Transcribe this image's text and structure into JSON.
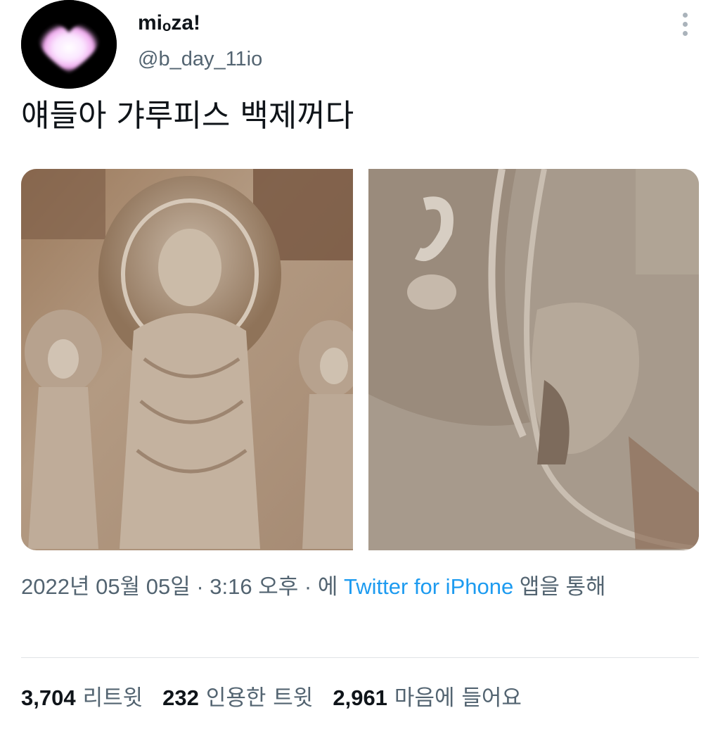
{
  "user": {
    "display_name": "miₒza!",
    "handle": "@b_day_11io"
  },
  "tweet": {
    "text": "얘들아 갸루피스 백제꺼다"
  },
  "meta": {
    "date": "2022년 05월 05일",
    "separator": " · ",
    "time": "3:16 오후",
    "via_prefix": "에 ",
    "source": "Twitter for iPhone",
    "via_suffix": " 앱을 통해"
  },
  "stats": [
    {
      "count": "3,704",
      "label": "리트윗"
    },
    {
      "count": "232",
      "label": "인용한 트윗"
    },
    {
      "count": "2,961",
      "label": "마음에 들어요"
    }
  ],
  "colors": {
    "accent": "#1d9bf0",
    "secondary_text": "#536471",
    "primary_text": "#0f1419"
  },
  "icons": {
    "avatar": "pink-heart",
    "more": "more-vertical-icon"
  }
}
